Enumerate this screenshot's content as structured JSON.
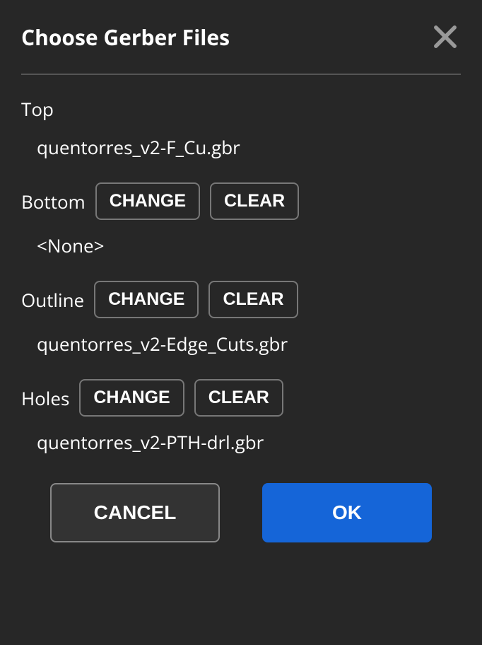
{
  "dialog": {
    "title": "Choose Gerber Files",
    "sections": {
      "top": {
        "label": "Top",
        "value": "quentorres_v2-F_Cu.gbr"
      },
      "bottom": {
        "label": "Bottom",
        "change": "CHANGE",
        "clear": "CLEAR",
        "value": "<None>"
      },
      "outline": {
        "label": "Outline",
        "change": "CHANGE",
        "clear": "CLEAR",
        "value": "quentorres_v2-Edge_Cuts.gbr"
      },
      "holes": {
        "label": "Holes",
        "change": "CHANGE",
        "clear": "CLEAR",
        "value": "quentorres_v2-PTH-drl.gbr"
      }
    },
    "footer": {
      "cancel": "CANCEL",
      "ok": "OK"
    }
  }
}
